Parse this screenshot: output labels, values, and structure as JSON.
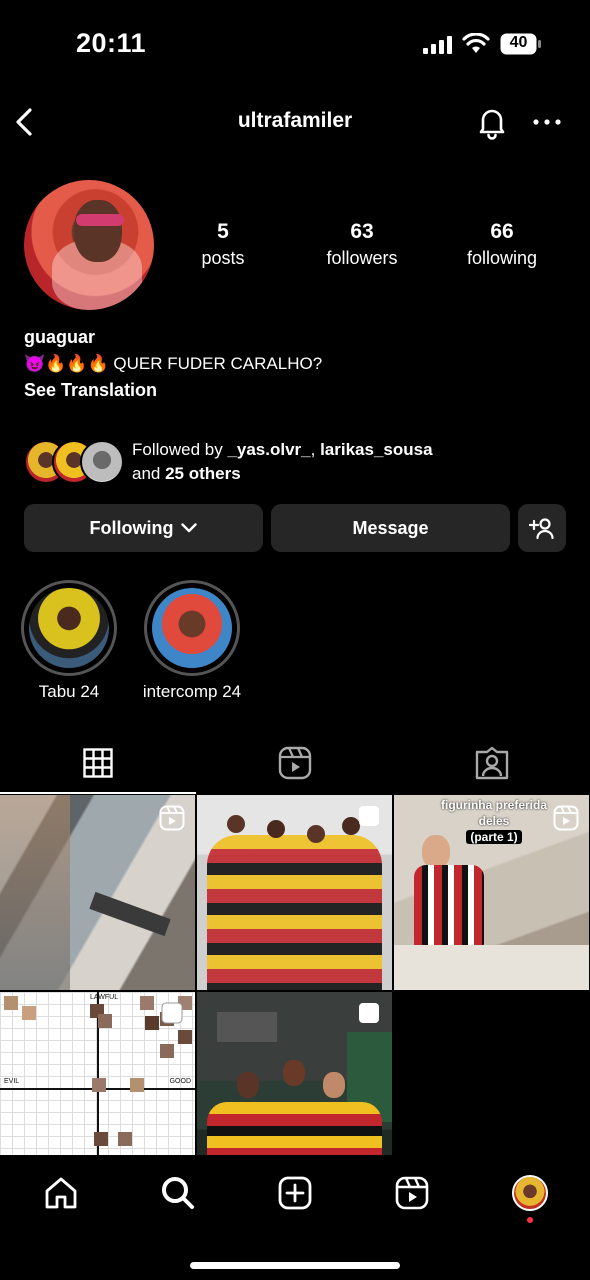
{
  "status_bar": {
    "time": "20:11",
    "battery": "40"
  },
  "header": {
    "title": "ultrafamiler"
  },
  "profile": {
    "stats": [
      {
        "value": "5",
        "label": "posts"
      },
      {
        "value": "63",
        "label": "followers"
      },
      {
        "value": "66",
        "label": "following"
      }
    ],
    "name": "guaguar",
    "bio_emojis": "😈🔥🔥🔥",
    "bio_text": "QUER FUDER CARALHO?",
    "see_translation": "See Translation"
  },
  "followed_by": {
    "prefix": "Followed by ",
    "user1": "_yas.olvr_",
    "separator": ", ",
    "user2": "larikas_sousa",
    "and_text": "and ",
    "others": "25 others"
  },
  "actions": {
    "following_label": "Following",
    "message_label": "Message"
  },
  "highlights": [
    {
      "label": "Tabu 24"
    },
    {
      "label": "intercomp 24"
    }
  ],
  "grid": {
    "post3_caption_line1": "figurinha preferida deles",
    "post3_caption_line2": "(parte 1)",
    "chart_left": "EVIL",
    "chart_right": "GOOD",
    "chart_top": "LAWFUL"
  },
  "colors": {
    "button_bg": "#262626",
    "notification_dot": "#ff3040",
    "ring": "#555555"
  }
}
